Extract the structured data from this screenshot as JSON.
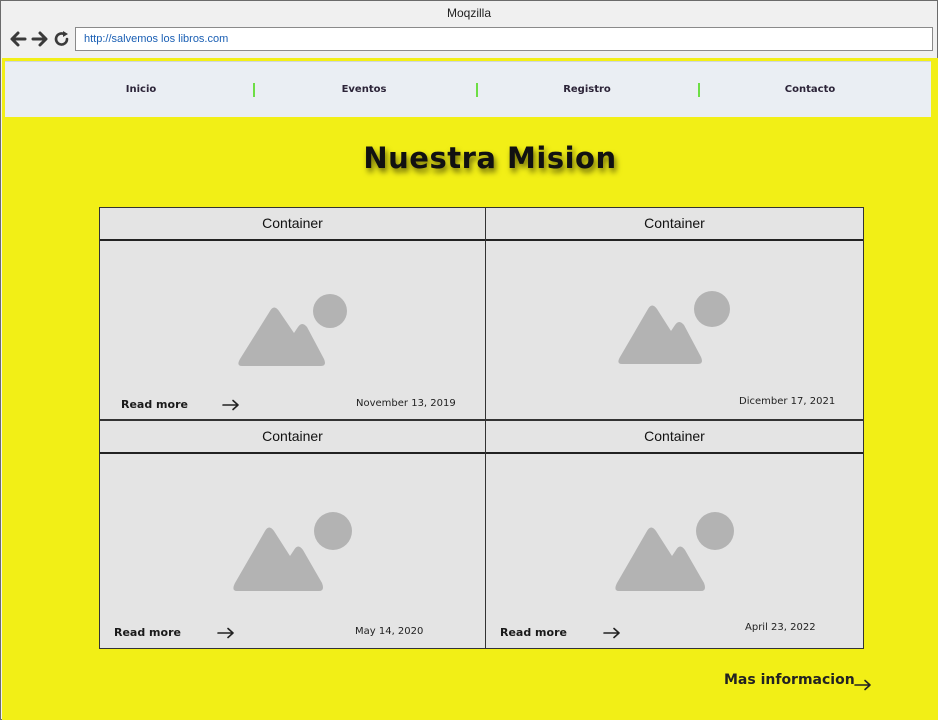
{
  "window": {
    "title": "Moqzilla"
  },
  "browser": {
    "url": "http://salvemos los libros.com",
    "back_icon": "arrow-left-icon",
    "forward_icon": "arrow-right-icon",
    "reload_icon": "reload-icon"
  },
  "navbar": {
    "items": [
      {
        "label": "Inicio"
      },
      {
        "label": "Eventos"
      },
      {
        "label": "Registro"
      },
      {
        "label": "Contacto"
      }
    ]
  },
  "main": {
    "title": "Nuestra Mision",
    "cards": [
      {
        "header": "Container",
        "read_more": "Read more",
        "date": "November 13, 2019"
      },
      {
        "header": "Container",
        "date": "Dicember 17, 2021"
      },
      {
        "header": "Container",
        "read_more": "Read more",
        "date": "May 14, 2020"
      },
      {
        "header": "Container",
        "read_more": "Read more",
        "date": "April 23, 2022"
      }
    ],
    "more_link": "Mas informacion"
  },
  "colors": {
    "background": "#f2ef16",
    "navbar": "#eaeef3",
    "separator": "#6dde45",
    "card": "#e4e4e4",
    "placeholder": "#b3b3b3"
  }
}
